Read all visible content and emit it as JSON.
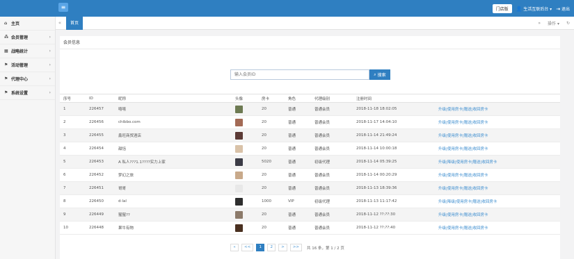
{
  "colors": {
    "primary": "#2f7fc1",
    "link": "#3c8dcf",
    "sidebar_bg": "#f6f6f6"
  },
  "topbar": {
    "menu_icon": "hamburger-icon",
    "store_button": "门店版",
    "user_label": "生活互联后台",
    "logout_label": "退出"
  },
  "sidebar": {
    "items": [
      {
        "icon": "home-icon",
        "label": "主页",
        "has_arrow": false
      },
      {
        "icon": "users-icon",
        "label": "会员管理",
        "has_arrow": true
      },
      {
        "icon": "chart-icon",
        "label": "战略统计",
        "has_arrow": true
      },
      {
        "icon": "flag-icon",
        "label": "活动管理",
        "has_arrow": true
      },
      {
        "icon": "flag-icon",
        "label": "代理中心",
        "has_arrow": true
      },
      {
        "icon": "flag-icon",
        "label": "系统设置",
        "has_arrow": true
      }
    ]
  },
  "tabs": {
    "active_tab": "首页",
    "ops_label": "操作"
  },
  "panel": {
    "title": "会员信息"
  },
  "search": {
    "placeholder": "输入会员ID",
    "button_label": "搜索"
  },
  "table": {
    "headers": [
      "序号",
      "ID",
      "昵称",
      "头像",
      "房卡",
      "角色",
      "代理级别",
      "注册时间",
      ""
    ],
    "rows": [
      {
        "no": "1",
        "id": "226457",
        "nick": "嘻嘻",
        "avatar": "#6d7a52",
        "card": "20",
        "role": "普通",
        "level": "普通会员",
        "time": "2018-11-18 18:02:05",
        "op": "升级|使用房卡|赠送|收回房卡"
      },
      {
        "no": "2",
        "id": "226456",
        "nick": "chibbo.com",
        "avatar": "#a36a55",
        "card": "20",
        "role": "普通",
        "level": "普通会员",
        "time": "2018-11-17 14:04:10",
        "op": "升级|使用房卡|赠送|收回房卡"
      },
      {
        "no": "3",
        "id": "226455",
        "nick": "鑫旺商贸酒店",
        "avatar": "#5b3a35",
        "card": "20",
        "role": "普通",
        "level": "普通会员",
        "time": "2018-11-14 21:49:24",
        "op": "升级|使用房卡|赠送|收回房卡"
      },
      {
        "no": "4",
        "id": "226454",
        "nick": "甜恬",
        "avatar": "#d9c2a8",
        "card": "20",
        "role": "普通",
        "level": "普通会员",
        "time": "2018-11-14 10:00:18",
        "op": "升级|使用房卡|赠送|收回房卡"
      },
      {
        "no": "5",
        "id": "226453",
        "nick": "A 私人???1.1????实力上家",
        "avatar": "#3c3c46",
        "card": "5020",
        "role": "普通",
        "level": "初级代理",
        "time": "2018-11-14 05:39:25",
        "op": "升级|降级|使用房卡|赠送|收回房卡"
      },
      {
        "no": "6",
        "id": "226452",
        "nick": "梦幻之旅",
        "avatar": "#c8a98a",
        "card": "20",
        "role": "普通",
        "level": "普通会员",
        "time": "2018-11-14 00:20:29",
        "op": "升级|使用房卡|赠送|收回房卡"
      },
      {
        "no": "7",
        "id": "226451",
        "nick": "哥哥",
        "avatar": "#e8e8e8",
        "card": "20",
        "role": "普通",
        "level": "普通会员",
        "time": "2018-11-13 18:39:36",
        "op": "升级|使用房卡|赠送|收回房卡"
      },
      {
        "no": "8",
        "id": "226450",
        "nick": "d-lal",
        "avatar": "#2e2e2e",
        "card": "1000",
        "role": "VIP",
        "level": "初级代理",
        "time": "2018-11-13 11:17:42",
        "op": "升级|降级|使用房卡|赠送|收回房卡"
      },
      {
        "no": "9",
        "id": "226449",
        "nick": "猩猩??",
        "avatar": "#8c7a6a",
        "card": "20",
        "role": "普通",
        "level": "普通会员",
        "time": "2018-11-12 ??:??:30",
        "op": "升级|使用房卡|赠送|收回房卡"
      },
      {
        "no": "10",
        "id": "226448",
        "nick": "果牛有物",
        "avatar": "#4a3020",
        "card": "20",
        "role": "普通",
        "level": "普通会员",
        "time": "2018-11-12 ??:??:40",
        "op": "升级|使用房卡|赠送|收回房卡"
      }
    ]
  },
  "pagination": {
    "first": "«",
    "prev": "<<",
    "pages": [
      "1",
      "2"
    ],
    "next": ">",
    "last": ">>",
    "current_page": "1",
    "info": "共 16 条，第 1 / 2 页"
  }
}
